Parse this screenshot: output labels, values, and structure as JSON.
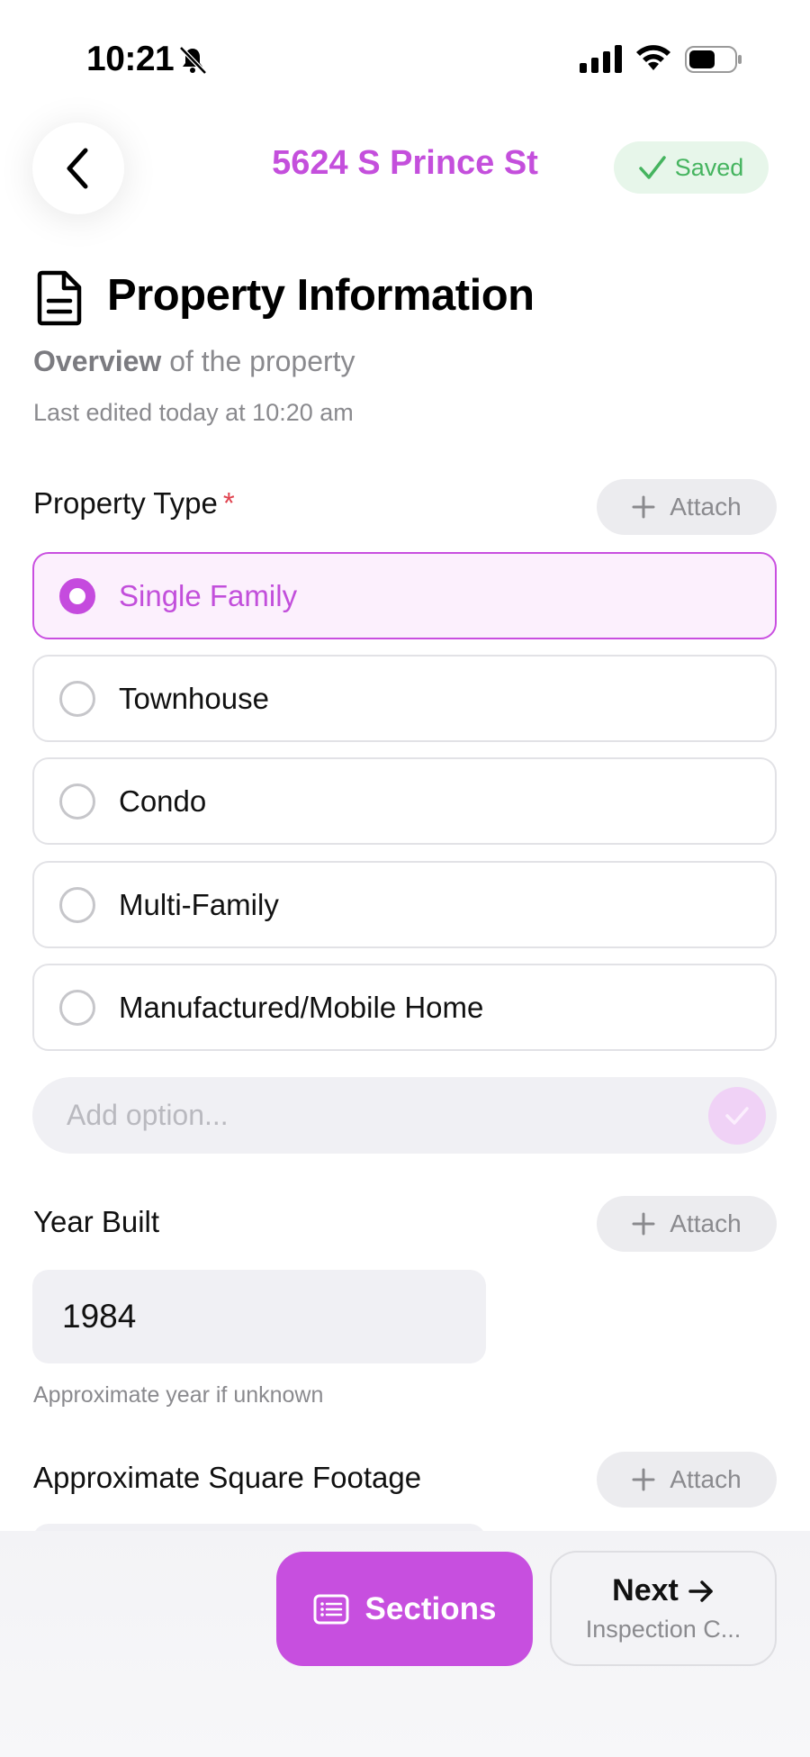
{
  "status_bar": {
    "time": "10:21",
    "icons": [
      "bell-slash-icon",
      "signal-icon",
      "wifi-icon",
      "battery-icon"
    ]
  },
  "header": {
    "back_icon": "chevron-left-icon",
    "title": "5624 S Prince St",
    "saved_label": "Saved"
  },
  "section": {
    "icon": "document-icon",
    "title": "Property Information",
    "subtitle_bold": "Overview",
    "subtitle_rest": " of the property",
    "last_edited": "Last edited today at 10:20 am"
  },
  "property_type": {
    "label": "Property Type",
    "required_marker": "*",
    "attach_label": "Attach",
    "options": [
      {
        "label": "Single Family",
        "selected": true
      },
      {
        "label": "Townhouse",
        "selected": false
      },
      {
        "label": "Condo",
        "selected": false
      },
      {
        "label": "Multi-Family",
        "selected": false
      },
      {
        "label": "Manufactured/Mobile Home",
        "selected": false
      }
    ],
    "add_option_placeholder": "Add option..."
  },
  "year_built": {
    "label": "Year Built",
    "attach_label": "Attach",
    "value": "1984",
    "helper": "Approximate year if unknown"
  },
  "square_footage": {
    "label": "Approximate Square Footage",
    "attach_label": "Attach"
  },
  "bottom_bar": {
    "sections_label": "Sections",
    "next_label": "Next",
    "next_sublabel": "Inspection C..."
  },
  "colors": {
    "accent": "#c74fdf",
    "accent_light": "#fcf0fd",
    "saved_green": "#45b45f",
    "required_red": "#e0434f"
  }
}
